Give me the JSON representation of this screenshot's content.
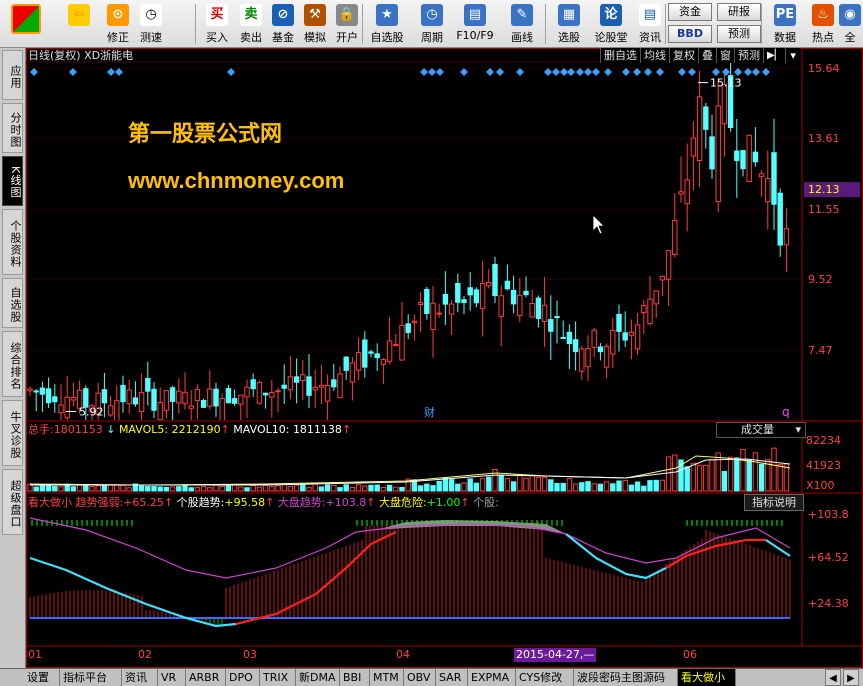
{
  "toolbar": {
    "buttons": [
      {
        "label": "",
        "icon": "tile-logo-icon"
      },
      {
        "label": "",
        "icon": "back-arrow-icon"
      },
      {
        "label": "修正",
        "icon": "repair-icon"
      },
      {
        "label": "测速",
        "icon": "speed-clock-icon"
      },
      {
        "label": "买入",
        "icon": "buy-icon",
        "glyph": "买"
      },
      {
        "label": "卖出",
        "icon": "sell-icon",
        "glyph": "卖"
      },
      {
        "label": "基金",
        "icon": "fund-icon"
      },
      {
        "label": "模拟",
        "icon": "hammer-icon"
      },
      {
        "label": "开户",
        "icon": "lock-icon"
      },
      {
        "label": "自选股",
        "icon": "star-folder-icon"
      },
      {
        "label": "周期",
        "icon": "period-clock-icon"
      },
      {
        "label": "F10/F9",
        "icon": "f10-icon"
      },
      {
        "label": "画线",
        "icon": "pen-icon"
      },
      {
        "label": "选股",
        "icon": "screen-icon"
      },
      {
        "label": "论股堂",
        "icon": "discuss-icon",
        "glyph": "论"
      },
      {
        "label": "资讯",
        "icon": "news-icon"
      },
      {
        "label": "数据",
        "icon": "pe-icon"
      },
      {
        "label": "热点",
        "icon": "hotspot-icon"
      },
      {
        "label": "全",
        "icon": "globe-icon"
      }
    ],
    "small": {
      "zijin": "资金",
      "yanbao": "研报",
      "bbd": "BBD",
      "yujing": "预测"
    }
  },
  "leftnav": [
    {
      "label": "应用",
      "active": false
    },
    {
      "label": "分时图",
      "active": false
    },
    {
      "label": "K线图",
      "active": true
    },
    {
      "label": "个股资料",
      "active": false
    },
    {
      "label": "自选股",
      "active": false
    },
    {
      "label": "综合排名",
      "active": false
    },
    {
      "label": "牛叉诊股",
      "active": false
    },
    {
      "label": "超级盘口",
      "active": false
    }
  ],
  "header": {
    "title": "日线(复权) XD浙能电",
    "tools": [
      "删自选",
      "均线",
      "复权",
      "叠",
      "窗",
      "预测"
    ]
  },
  "watermark": {
    "line1": "第一股票公式网",
    "line2": "www.chnmoney.com"
  },
  "price_axis": {
    "ticks": [
      "15.64",
      "13.61",
      "12.13",
      "11.55",
      "9.52",
      "7.47"
    ],
    "current": "12.13"
  },
  "annotations": {
    "high": "15.13",
    "low": "5.92",
    "cai": "财",
    "q": "q"
  },
  "volume": {
    "total_label": "总手:",
    "total_value": "1801153",
    "mavol5_label": "MAVOL5:",
    "mavol5_value": "2212190",
    "mavol10_label": "MAVOL10:",
    "mavol10_value": "1811138",
    "selector": "成交量",
    "ticks": [
      "82234",
      "41923",
      "X100"
    ]
  },
  "indicator": {
    "name": "看大做小",
    "strength_label": "趋势强弱:",
    "strength_value": "+65.25",
    "stock_label": "个股趋势:",
    "stock_value": "+95.58",
    "market_label": "大盘趋势:",
    "market_value": "+103.8",
    "danger_label": "大盘危险:",
    "danger_value": "+1.00",
    "gegu_label": "个股:",
    "help": "指标说明",
    "ticks": [
      "+103.8",
      "+64.52",
      "+24.38"
    ]
  },
  "xaxis": {
    "labels": [
      "01",
      "02",
      "03",
      "04",
      "06"
    ],
    "cursor_date": "2015-04-27,—"
  },
  "bottom_tabs": [
    "设置",
    "指标平台",
    "资讯",
    "VR",
    "ARBR",
    "DPO",
    "TRIX",
    "新DMA",
    "BBI",
    "MTM",
    "OBV",
    "SAR",
    "EXPMA",
    "CYS修改",
    "波段密码主图源码",
    "看大做小"
  ],
  "active_tab": "看大做小",
  "colors": {
    "up": "#ff3c3c",
    "down": "#54ffff",
    "axis": "#b00000",
    "text_yellow": "#ffff00",
    "watermark": "#ffc000",
    "signal": "#3ca0ff",
    "magenta": "#cc44cc",
    "green": "#00ff00"
  }
}
